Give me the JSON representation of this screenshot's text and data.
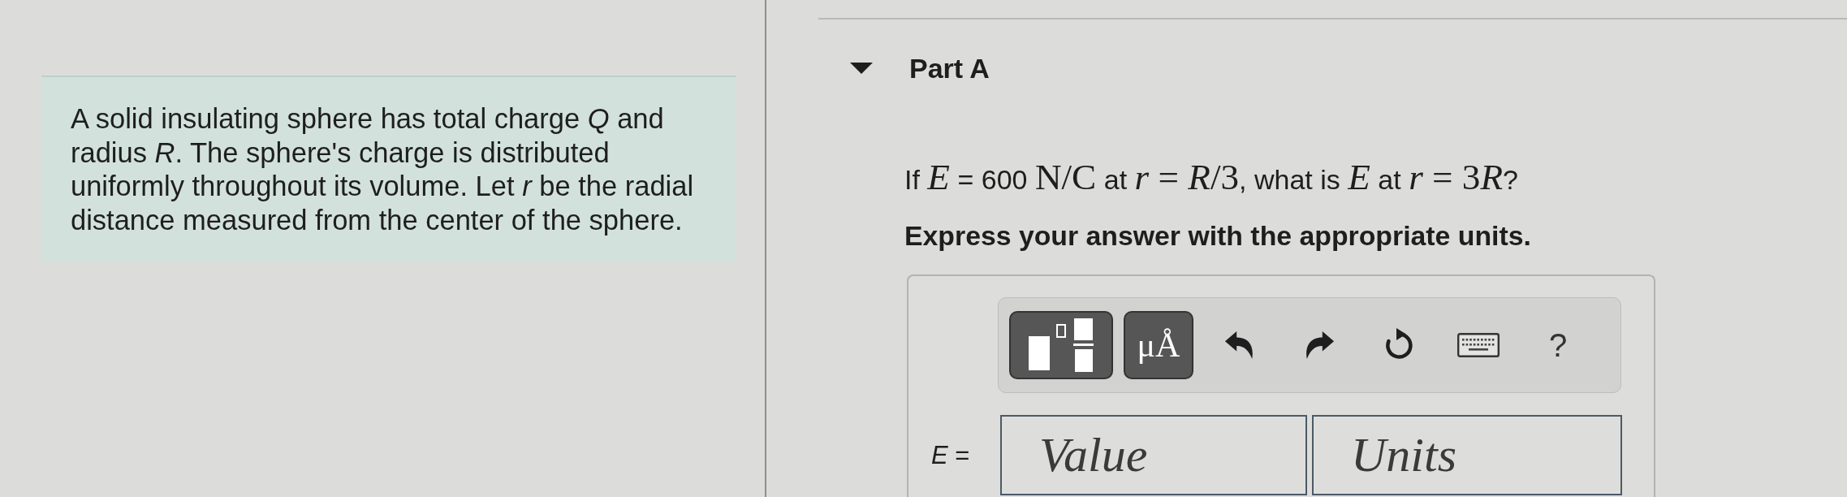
{
  "problem": {
    "text": "A solid insulating sphere has total charge *Q* and radius *R*. The sphere's charge is distributed uniformly throughout its volume. Let *r* be the radial distance measured from the center of the sphere."
  },
  "part": {
    "label": "Part A",
    "expanded": true
  },
  "question": {
    "segments": [
      {
        "kind": "text",
        "text": "If "
      },
      {
        "kind": "var",
        "text": "E"
      },
      {
        "kind": "text",
        "text": " = 600 "
      },
      {
        "kind": "sym",
        "text": "N/C"
      },
      {
        "kind": "text",
        "text": " at "
      },
      {
        "kind": "var",
        "text": "r"
      },
      {
        "kind": "sym",
        "text": " = "
      },
      {
        "kind": "var",
        "text": "R"
      },
      {
        "kind": "sym",
        "text": "/3"
      },
      {
        "kind": "text",
        "text": ", what is "
      },
      {
        "kind": "var",
        "text": "E"
      },
      {
        "kind": "text",
        "text": " at "
      },
      {
        "kind": "var",
        "text": "r"
      },
      {
        "kind": "sym",
        "text": " = 3"
      },
      {
        "kind": "var",
        "text": "R"
      },
      {
        "kind": "text",
        "text": "?"
      }
    ],
    "instruction": "Express your answer with the appropriate units."
  },
  "answer": {
    "toolbar": [
      {
        "kind": "templates"
      },
      {
        "kind": "units",
        "label": "μÅ"
      },
      {
        "kind": "undo"
      },
      {
        "kind": "redo"
      },
      {
        "kind": "reset"
      },
      {
        "kind": "keyboard"
      },
      {
        "kind": "help",
        "label": "?"
      }
    ],
    "variable": "*E* =",
    "value_placeholder": "Value",
    "units_placeholder": "Units"
  }
}
